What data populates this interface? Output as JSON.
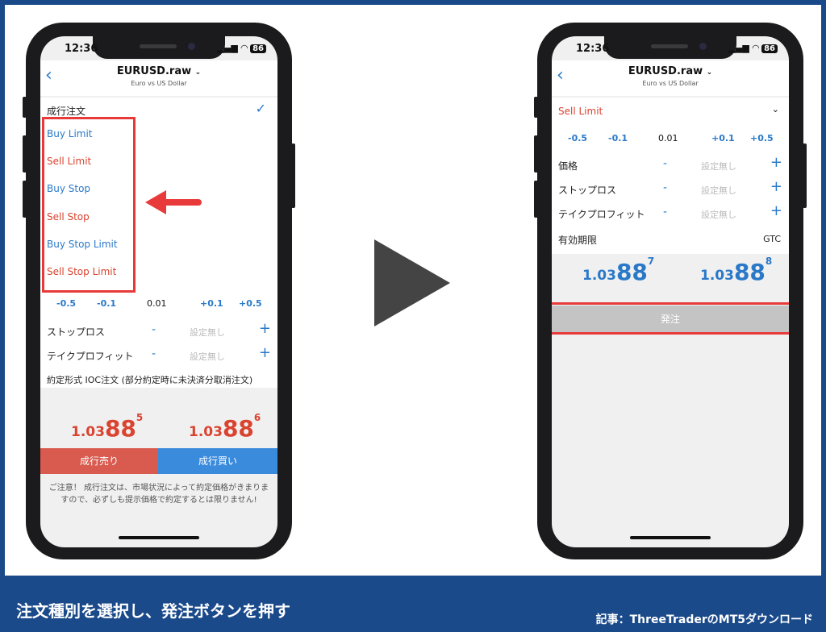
{
  "caption": "注文種別を選択し、発注ボタンを押す",
  "source": "記事：ThreeTraderのMT5ダウンロード",
  "left_phone": {
    "time": "12:36",
    "battery": "86",
    "symbol": "EURUSD.raw",
    "description": "Euro vs US Dollar",
    "order_type": "成行注文",
    "check": "✓",
    "order_options": [
      "Buy Limit",
      "Sell Limit",
      "Buy Stop",
      "Sell Stop",
      "Buy Stop Limit",
      "Sell Stop Limit"
    ],
    "steps": [
      "-0.5",
      "-0.1",
      "0.01",
      "+0.1",
      "+0.5"
    ],
    "stop_loss_label": "ストップロス",
    "take_profit_label": "テイクプロフィット",
    "not_set": "設定無し",
    "minus": "-",
    "plus": "+",
    "fill_type": "約定形式 IOC注文 (部分約定時に未決済分取消注文)",
    "bid": {
      "prefix": "1.03",
      "big": "88",
      "sup": "5"
    },
    "ask": {
      "prefix": "1.03",
      "big": "88",
      "sup": "6"
    },
    "sell_button": "成行売り",
    "buy_button": "成行買い",
    "notice": "ご注意！ 成行注文は、市場状況によって約定価格がきまりますので、必ずしも提示価格で約定するとは限りません!"
  },
  "right_phone": {
    "time": "12:36",
    "battery": "86",
    "symbol": "EURUSD.raw",
    "description": "Euro vs US Dollar",
    "order_type": "Sell Limit",
    "steps": [
      "-0.5",
      "-0.1",
      "0.01",
      "+0.1",
      "+0.5"
    ],
    "price_label": "価格",
    "stop_loss_label": "ストップロス",
    "take_profit_label": "テイクプロフィット",
    "not_set": "設定無し",
    "minus": "-",
    "plus": "+",
    "expiry_label": "有効期限",
    "expiry_value": "GTC",
    "bid": {
      "prefix": "1.03",
      "big": "88",
      "sup": "7"
    },
    "ask": {
      "prefix": "1.03",
      "big": "88",
      "sup": "8"
    },
    "order_button": "発注"
  },
  "colors": {
    "blue": "#2a79c9",
    "red": "#d9432f",
    "highlight": "#e83a3a",
    "footer": "#1a4a8a"
  }
}
